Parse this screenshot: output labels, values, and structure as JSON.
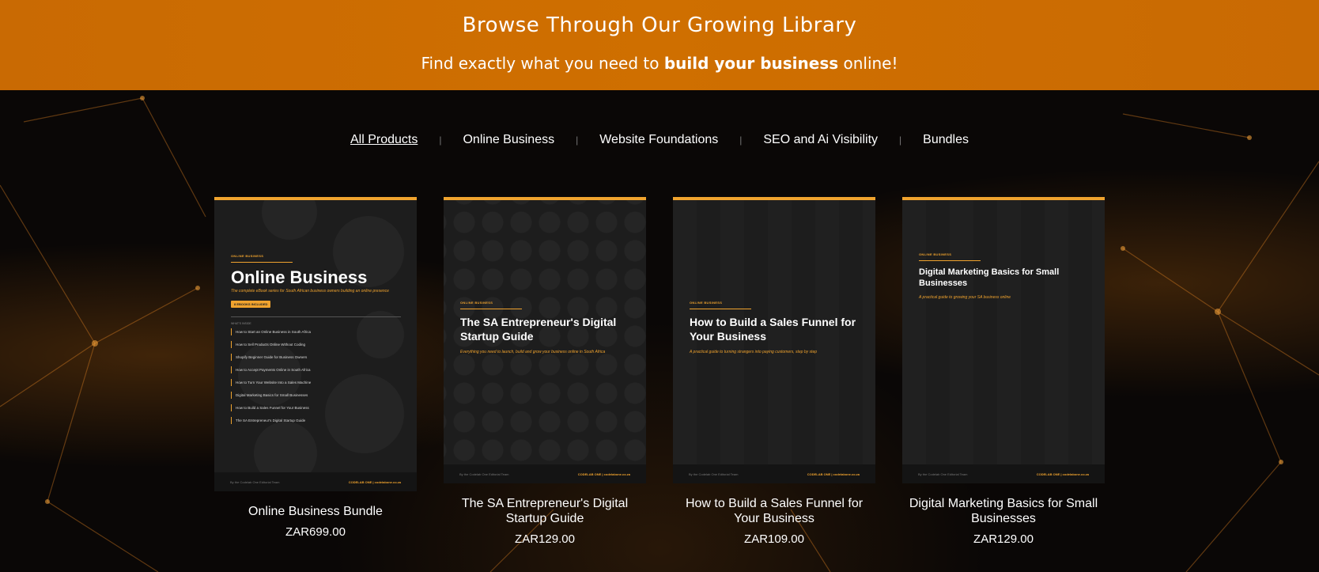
{
  "banner": {
    "title": "Browse Through Our Growing Library",
    "sub_prefix": "Find exactly what you need to ",
    "sub_bold": "build your business",
    "sub_suffix": " online!",
    "color": "#cf6f00"
  },
  "nav": {
    "items": [
      {
        "label": "All Products",
        "active": true
      },
      {
        "label": "Online Business"
      },
      {
        "label": "Website Foundations"
      },
      {
        "label": "SEO and Ai Visibility"
      },
      {
        "label": "Bundles"
      }
    ]
  },
  "accent_color": "#f0a32e",
  "products": [
    {
      "name": "Online Business Bundle",
      "price": "ZAR699.00",
      "cover": {
        "category": "ONLINE BUSINESS",
        "title": "Online Business",
        "tagline": "The complete eBook series for South African business owners building an online presence",
        "pill": "8 EBOOKS INCLUDED",
        "inside_label": "WHAT'S INSIDE",
        "list": [
          "How to Start an Online Business in South Africa",
          "How to Sell Products Online Without Coding",
          "Shopify Beginner Guide for Business Owners",
          "How to Accept Payments Online in South Africa",
          "How to Turn Your Website Into a Sales Machine",
          "Digital Marketing Basics for Small Businesses",
          "How to Build a Sales Funnel for Your Business",
          "The SA Entrepreneur's Digital Startup Guide"
        ],
        "footer_left": "By the Codelab One Editorial Team",
        "footer_right": "CODELAB ONE | codelabone.co.za"
      }
    },
    {
      "name": "The SA Entrepreneur's Digital Startup Guide",
      "price": "ZAR129.00",
      "cover": {
        "category": "ONLINE BUSINESS",
        "title": "The SA Entrepreneur's Digital Startup Guide",
        "tagline": "Everything you need to launch, build and grow your business online in South Africa",
        "footer_left": "By the Codelab One Editorial Team",
        "footer_right": "CODELAB ONE | codelabone.co.za"
      }
    },
    {
      "name": "How to Build a Sales Funnel for Your Business",
      "price": "ZAR109.00",
      "cover": {
        "category": "ONLINE BUSINESS",
        "title": "How to Build a Sales Funnel for Your Business",
        "tagline": "A practical guide to turning strangers into paying customers, step by step",
        "footer_left": "By the Codelab One Editorial Team",
        "footer_right": "CODELAB ONE | codelabone.co.za"
      }
    },
    {
      "name": "Digital Marketing Basics for Small Businesses",
      "price": "ZAR129.00",
      "cover": {
        "category": "ONLINE BUSINESS",
        "title": "Digital Marketing Basics for Small Businesses",
        "tagline": "A practical guide to growing your SA business online",
        "footer_left": "By the Codelab One Editorial Team",
        "footer_right": "CODELAB ONE | codelabone.co.za"
      }
    }
  ]
}
